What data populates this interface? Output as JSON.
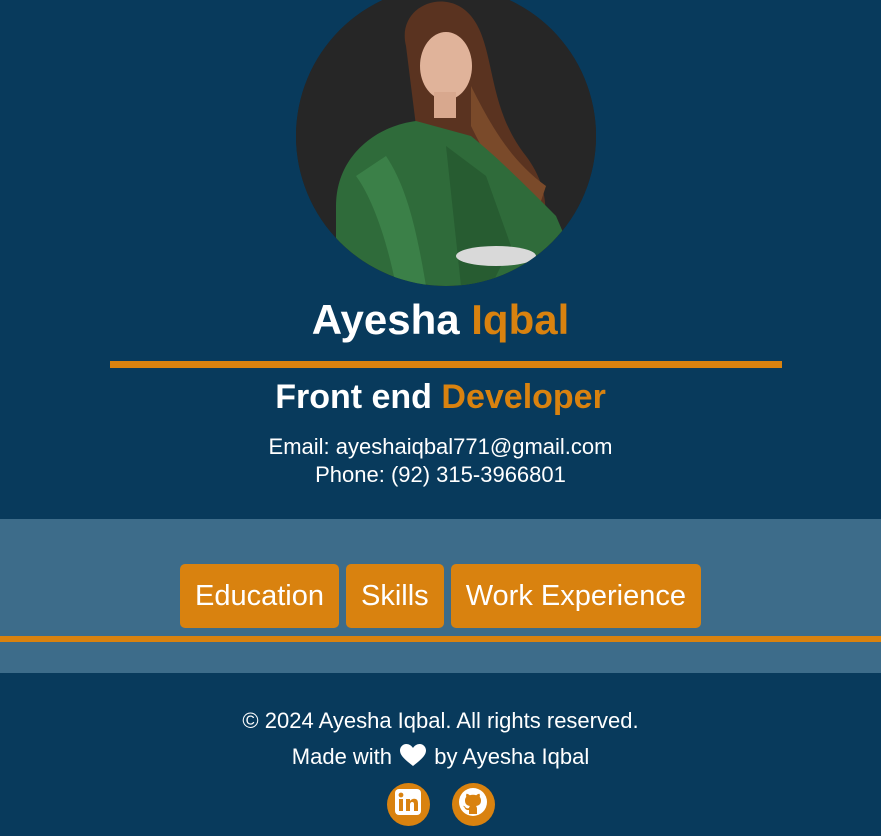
{
  "profile": {
    "first_name": "Ayesha",
    "last_name": "Iqbal",
    "role_prefix": "Front end",
    "role_accent": "Developer",
    "email_line": "Email: ayeshaiqbal771@gmail.com",
    "phone_line": "Phone: (92) 315-3966801"
  },
  "nav": {
    "items": [
      {
        "label": "Education"
      },
      {
        "label": "Skills"
      },
      {
        "label": "Work Experience"
      }
    ]
  },
  "footer": {
    "copyright": "© 2024 Ayesha Iqbal. All rights reserved.",
    "made_with_prefix": "Made with",
    "made_with_suffix": "by Ayesha Iqbal",
    "icons": [
      "heart-icon",
      "linkedin-icon",
      "github-icon"
    ]
  },
  "colors": {
    "dark_blue": "#083a5c",
    "mid_blue": "#3d6c8a",
    "accent_orange": "#d9820f",
    "text_white": "#ffffff"
  }
}
